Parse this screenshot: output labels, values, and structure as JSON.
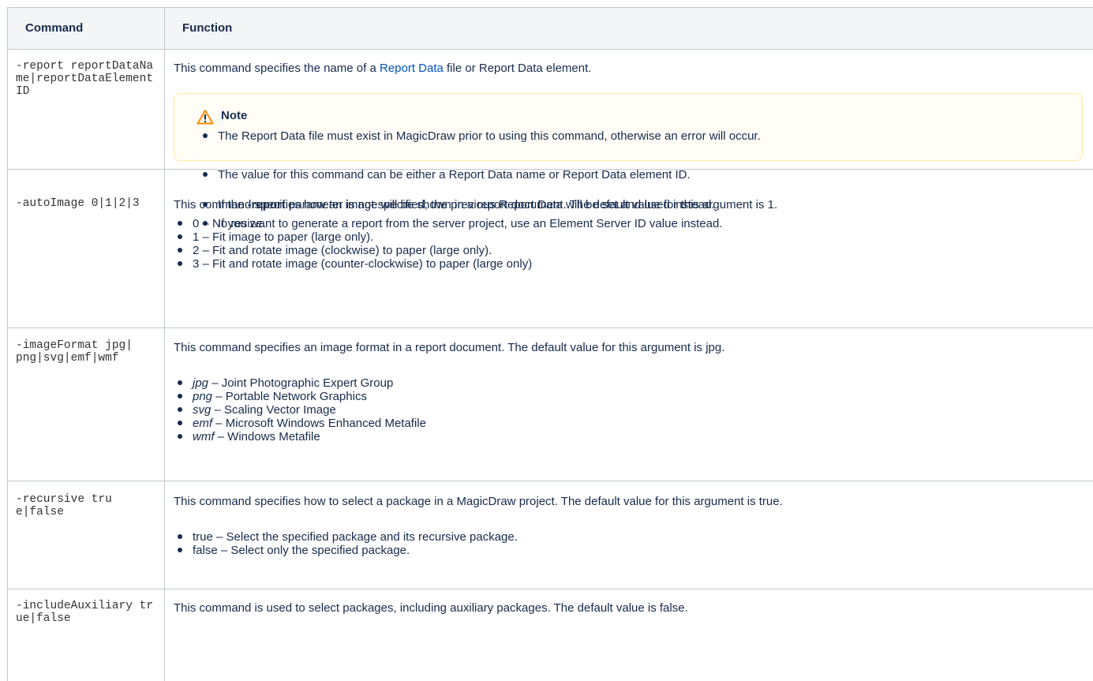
{
  "table": {
    "headers": {
      "command": "Command",
      "function": "Function"
    },
    "rows": [
      {
        "command": "-report reportDataName|reportDataElementID",
        "intro_pre": "This command specifies the name of a ",
        "intro_link": "Report Data",
        "intro_post": " file or Report Data element.",
        "note": {
          "title": "Note",
          "items": [
            "The Report Data file must exist in MagicDraw prior to using this command, otherwise an error will occur.",
            "The value for this command can be either a Report Data name or Report Data element ID."
          ],
          "item3_pre": "If the ",
          "item3_bold": "-report",
          "item3_post": " parameter is not specified, the previous Report Data will be set and used instead.",
          "item4": "If you want to generate a report from the server project, use an Element Server ID value instead."
        }
      },
      {
        "command": "-autoImage 0|1|2|3",
        "intro": "This command specifies how an image will be shown in a report document. The default value for this argument is 1.",
        "items": [
          "0 – No resize.",
          "1 – Fit image to paper (large only).",
          "2 – Fit and rotate image (clockwise) to paper (large only).",
          "3 – Fit and rotate image (counter-clockwise) to paper (large only)"
        ]
      },
      {
        "command": "-imageFormat jpg|png|svg|emf|wmf",
        "intro": "This command specifies an image format in a report document. The default value for this argument is jpg.",
        "items": [
          {
            "term": "jpg",
            "desc": " – Joint Photographic Expert Group"
          },
          {
            "term": "png",
            "desc": " – Portable Network Graphics"
          },
          {
            "term": "svg",
            "desc": " – Scaling Vector Image"
          },
          {
            "term": "emf",
            "desc": " – Microsoft Windows Enhanced Metafile"
          },
          {
            "term": "wmf",
            "desc": " – Windows Metafile"
          }
        ]
      },
      {
        "command": "-recursive true|false",
        "intro": "This command specifies how to select a package in a MagicDraw project. The default value for this argument is true.",
        "items": [
          "true – Select the specified package and its recursive package.",
          "false – Select only the specified package."
        ]
      },
      {
        "command": "-includeAuxiliary true|false",
        "intro": "This command is used to select packages, including auxiliary packages. The default value is false."
      }
    ]
  },
  "icons": {
    "note": "warning-icon"
  },
  "colors": {
    "link": "#0052cc",
    "header_bg": "#f4f5f7",
    "note_border": "#ffeaa8",
    "note_bg": "#fffdf6",
    "border": "#c1c7d0"
  }
}
